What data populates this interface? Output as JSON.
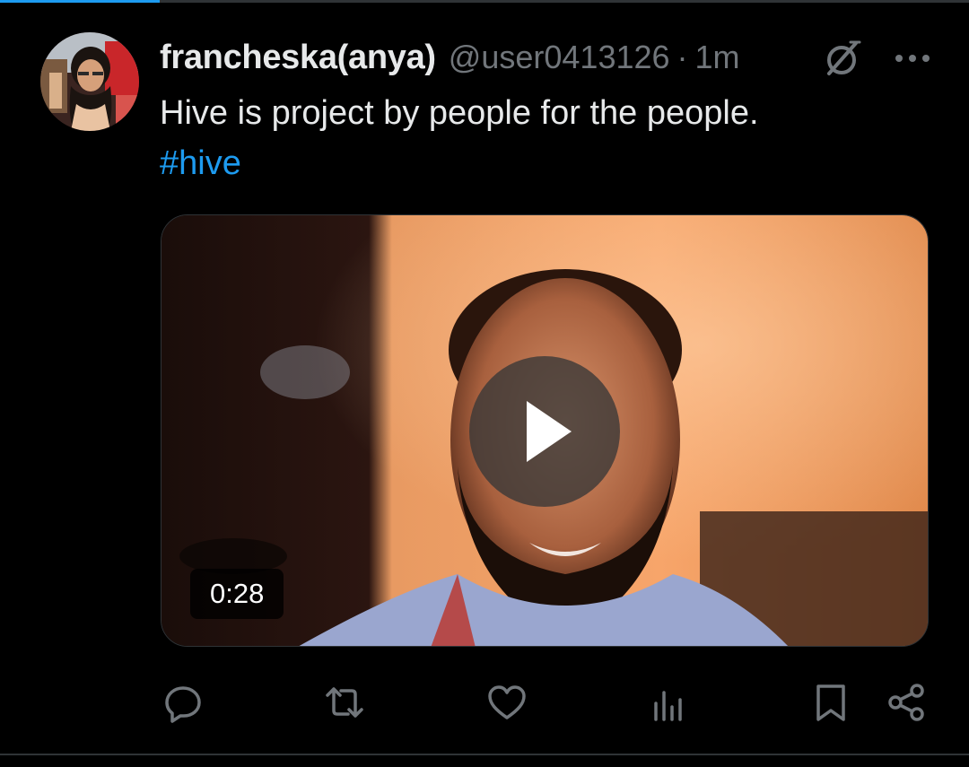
{
  "post": {
    "display_name": "francheska(anya)",
    "handle": "@user0413126",
    "separator": "·",
    "time": "1m",
    "text": "Hive is project by people for the people.",
    "hashtag": "#hive"
  },
  "media": {
    "type": "video",
    "duration": "0:28",
    "play_icon": "play-icon"
  },
  "actions": {
    "reply_icon": "reply-icon",
    "repost_icon": "repost-icon",
    "like_icon": "heart-icon",
    "views_icon": "analytics-icon",
    "bookmark_icon": "bookmark-icon",
    "share_icon": "share-icon"
  },
  "colors": {
    "background": "#000000",
    "primary_text": "#e7e9ea",
    "secondary_text": "#71767b",
    "accent": "#1d9bf0",
    "divider": "#2f3336"
  }
}
